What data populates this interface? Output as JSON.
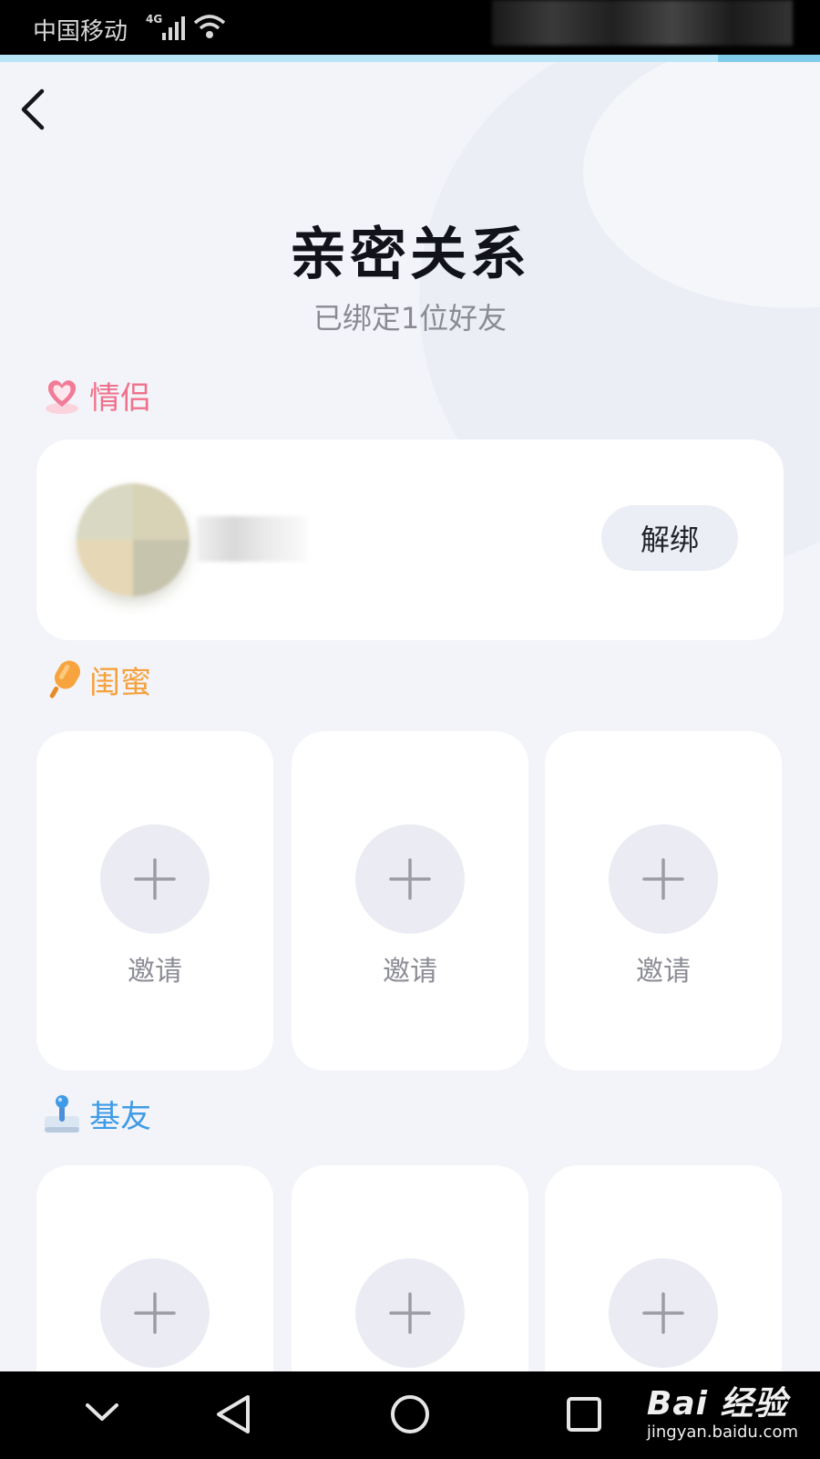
{
  "status_bar": {
    "carrier": "中国移动",
    "network": "4G",
    "icons": [
      "signal-icon",
      "wifi-icon"
    ]
  },
  "header": {
    "back_icon": "back-arrow-icon",
    "title": "亲密关系",
    "subtitle": "已绑定1位好友"
  },
  "sections": {
    "couple": {
      "label": "情侣",
      "icon": "heart-icon",
      "color": "#f0708b",
      "unbind_label": "解绑"
    },
    "bestie": {
      "label": "闺蜜",
      "icon": "popsicle-icon",
      "color": "#f5a13c",
      "slots": [
        {
          "icon": "plus-icon",
          "label": "邀请"
        },
        {
          "icon": "plus-icon",
          "label": "邀请"
        },
        {
          "icon": "plus-icon",
          "label": "邀请"
        }
      ]
    },
    "buddy": {
      "label": "基友",
      "icon": "joystick-icon",
      "color": "#3f9be6",
      "slots": [
        {
          "icon": "plus-icon"
        },
        {
          "icon": "plus-icon"
        },
        {
          "icon": "plus-icon"
        }
      ]
    }
  },
  "nav_bar": {
    "icons": [
      "collapse-icon",
      "back-triangle-icon",
      "home-circle-icon",
      "recents-square-icon"
    ],
    "watermark_brand": "Bai 经验",
    "watermark_url": "jingyan.baidu.com"
  },
  "colors": {
    "background": "#f3f4f9",
    "accent_line": "#b9e6f7",
    "plus_circle": "#ebebf3"
  }
}
